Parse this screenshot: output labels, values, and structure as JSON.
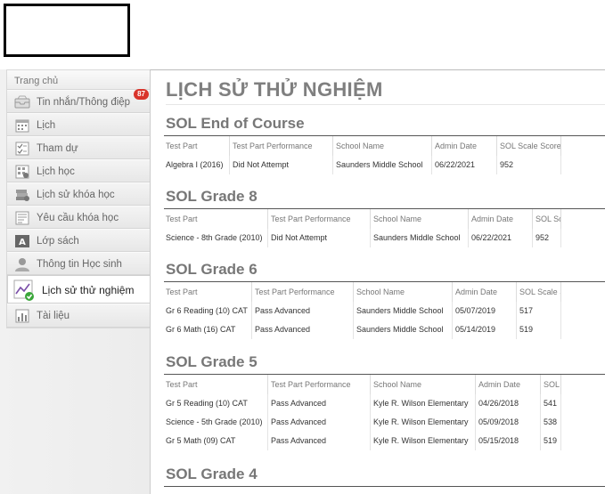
{
  "sidebar": {
    "home": "Trang chủ",
    "items": [
      {
        "label": "Tin nhắn/Thông điệp",
        "badge": "87",
        "icon": "inbox-icon"
      },
      {
        "label": "Lịch",
        "icon": "calendar-icon"
      },
      {
        "label": "Tham dự",
        "icon": "attendance-icon"
      },
      {
        "label": "Lịch học",
        "icon": "schedule-icon"
      },
      {
        "label": "Lịch sử khóa học",
        "icon": "books-icon"
      },
      {
        "label": "Yêu cầu khóa học",
        "icon": "request-icon"
      },
      {
        "label": "Lớp sách",
        "icon": "font-icon"
      },
      {
        "label": "Thông tin Học sinh",
        "icon": "person-icon"
      }
    ],
    "active": {
      "label": "Lịch sử thử nghiệm",
      "icon": "test-history-icon"
    },
    "last": {
      "label": "Tài liệu",
      "icon": "chart-icon"
    }
  },
  "main": {
    "title": "LỊCH SỬ THỬ NGHIỆM",
    "sections": [
      {
        "heading": "SOL End of Course",
        "headers": [
          "Test Part",
          "Test Part Performance",
          "School Name",
          "Admin Date",
          "SOL Scale Score"
        ],
        "rows": [
          [
            "Algebra I (2016)",
            "Did Not Attempt",
            "Saunders Middle School",
            "06/22/2021",
            "952"
          ]
        ]
      },
      {
        "heading": "SOL Grade 8",
        "headers": [
          "Test Part",
          "Test Part Performance",
          "School Name",
          "Admin Date",
          "SOL Scale Score"
        ],
        "rows": [
          [
            "Science - 8th Grade (2010)",
            "Did Not Attempt",
            "Saunders Middle School",
            "06/22/2021",
            "952"
          ]
        ]
      },
      {
        "heading": "SOL Grade 6",
        "headers": [
          "Test Part",
          "Test Part Performance",
          "School Name",
          "Admin Date",
          "SOL Scale Score"
        ],
        "rows": [
          [
            "Gr 6 Reading (10) CAT",
            "Pass Advanced",
            "Saunders Middle School",
            "05/07/2019",
            "517"
          ],
          [
            "Gr 6 Math (16) CAT",
            "Pass Advanced",
            "Saunders Middle School",
            "05/14/2019",
            "519"
          ]
        ]
      },
      {
        "heading": "SOL Grade 5",
        "headers": [
          "Test Part",
          "Test Part Performance",
          "School Name",
          "Admin Date",
          "SOL Scale Score"
        ],
        "rows": [
          [
            "Gr 5 Reading (10) CAT",
            "Pass Advanced",
            "Kyle R. Wilson Elementary",
            "04/26/2018",
            "541"
          ],
          [
            "Science - 5th Grade (2010)",
            "Pass Advanced",
            "Kyle R. Wilson Elementary",
            "05/09/2018",
            "538"
          ],
          [
            "Gr 5 Math (09) CAT",
            "Pass Advanced",
            "Kyle R. Wilson Elementary",
            "05/15/2018",
            "519"
          ]
        ]
      },
      {
        "heading": "SOL Grade 4",
        "headers": [],
        "rows": []
      }
    ]
  }
}
